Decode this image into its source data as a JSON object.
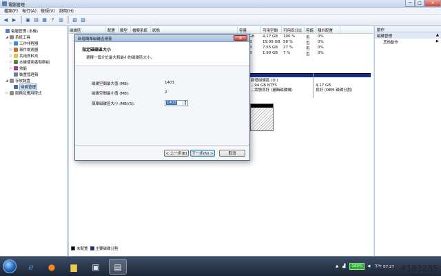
{
  "window": {
    "title": "電腦管理",
    "controls": {
      "minimize": "─",
      "maximize": "□",
      "close": "✕"
    }
  },
  "menu": [
    "檔案(F)",
    "執行(A)",
    "檢視(V)",
    "說明(H)"
  ],
  "toolbar_icons": [
    "back-arrow-icon",
    "forward-arrow-icon",
    "up-folder-icon",
    "show-tree-icon",
    "properties-icon",
    "help-icon",
    "console-icon",
    "disk-properties-icon"
  ],
  "tree": [
    {
      "label": "電腦管理 (本機)",
      "indent": 0,
      "icon": "computer-icon",
      "color": "#5b7fb5",
      "expander": ""
    },
    {
      "label": "系統工具",
      "indent": 1,
      "icon": "tools-icon",
      "color": "#8a8a8a",
      "expander": "◢"
    },
    {
      "label": "工作排程器",
      "indent": 2,
      "icon": "clock-icon",
      "color": "#3a8fd9",
      "expander": "▷"
    },
    {
      "label": "事件檢視器",
      "indent": 2,
      "icon": "event-icon",
      "color": "#c96b2d",
      "expander": "▷"
    },
    {
      "label": "共用資料夾",
      "indent": 2,
      "icon": "folder-icon",
      "color": "#e7c04c",
      "expander": "▷"
    },
    {
      "label": "本機使用者和群組",
      "indent": 2,
      "icon": "users-icon",
      "color": "#4f8a3f",
      "expander": "▷"
    },
    {
      "label": "效能",
      "indent": 2,
      "icon": "performance-icon",
      "color": "#9a3c8a",
      "expander": "▷"
    },
    {
      "label": "裝置管理員",
      "indent": 2,
      "icon": "device-icon",
      "color": "#6d7f95",
      "expander": ""
    },
    {
      "label": "存放裝置",
      "indent": 1,
      "icon": "storage-icon",
      "color": "#8a8a8a",
      "expander": "◢"
    },
    {
      "label": "磁碟管理",
      "indent": 2,
      "icon": "disk-icon",
      "color": "#4a6fa5",
      "expander": "",
      "selected": true
    },
    {
      "label": "服務及應用程式",
      "indent": 1,
      "icon": "services-icon",
      "color": "#8a8a8a",
      "expander": "▷"
    }
  ],
  "volume_table": {
    "headers": [
      "磁碟區",
      "配置",
      "類型",
      "檔案系統",
      "狀態",
      "容量",
      "可用空間",
      "可用百分比",
      "容錯",
      "額外配置"
    ],
    "rows": [
      {
        "capacity": "4.17 GB",
        "free": "4.17 GB",
        "pct": "100 %",
        "fault": "否",
        "overhead": "0%"
      },
      {
        "capacity": "...8 GB",
        "free": "19.99 GB",
        "pct": "58 %",
        "fault": "否",
        "overhead": "0%"
      },
      {
        "capacity": "...8 GB",
        "free": "7.55 GB",
        "pct": "27 %",
        "fault": "否",
        "overhead": "0%"
      },
      {
        "capacity": "...8 GB",
        "free": "1.90 GB",
        "pct": "7 %",
        "fault": "否",
        "overhead": "0%"
      }
    ]
  },
  "disk_map": {
    "part1": {
      "name": "新增磁碟區 (D:)",
      "size": "...94 GB NTFS",
      "status": "...狀態良好 (邏輯磁碟機)"
    },
    "part2": {
      "size": "4.17 GB",
      "status": "良好 (OEM 磁碟分割)"
    }
  },
  "legend": [
    {
      "label": "未配置",
      "color": "#000000"
    },
    {
      "label": "主要磁碟分割",
      "color": "#1a2c8a"
    }
  ],
  "actions": {
    "header": "動作",
    "section": "磁碟管理",
    "item": "其他動作",
    "arrow_section": "▲",
    "arrow_item": "▶"
  },
  "dialog": {
    "title": "新增簡單磁碟區精靈",
    "close": "✕",
    "header_title": "指定磁碟區大小",
    "header_subtitle": "選擇一個介於最大和最小的磁碟區大小。",
    "fields": [
      {
        "label": "磁碟空間最大值 (MB):",
        "value": "1403"
      },
      {
        "label": "磁碟空間最小值 (MB):",
        "value": "2"
      }
    ],
    "size_label": "簡單磁碟區大小 (MB)(S):",
    "size_value": "1403",
    "buttons": {
      "back": "< 上一步(B)",
      "next": "下一步(N) >",
      "cancel": "取消"
    }
  },
  "taskbar": {
    "apps": [
      "ie-icon",
      "firefox-icon",
      "explorer-icon",
      "media-icon",
      "computer-management-icon"
    ],
    "battery": "100%",
    "clock": "下午 07:27"
  },
  "watermark": "#103285"
}
